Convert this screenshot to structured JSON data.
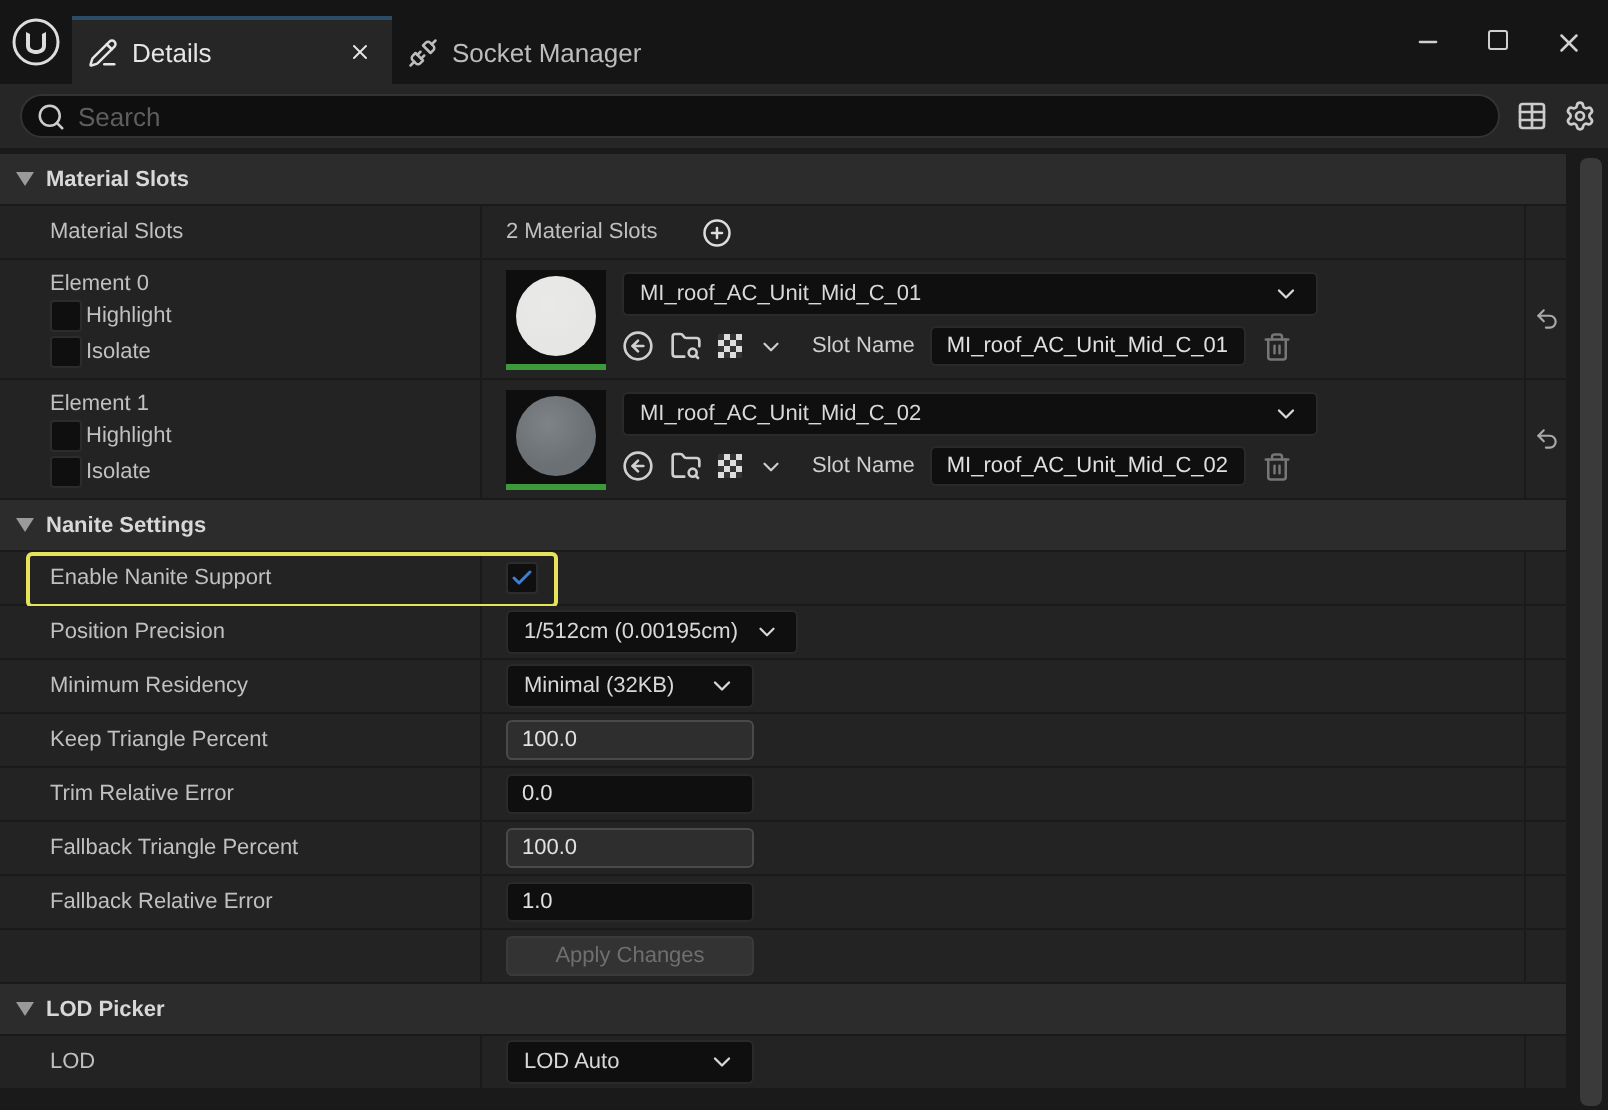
{
  "tabs": [
    {
      "label": "Details",
      "selected": true,
      "closable": true
    },
    {
      "label": "Socket Manager",
      "selected": false,
      "closable": false
    }
  ],
  "search": {
    "placeholder": "Search"
  },
  "sections": [
    {
      "title": "Material Slots",
      "expanded": true,
      "rows": [
        {
          "kind": "count",
          "label": "Material Slots",
          "value": "2 Material Slots"
        },
        {
          "kind": "material",
          "label": "Element 0",
          "color": "#e6e6e4",
          "options": [
            {
              "label": "Highlight",
              "checked": false
            },
            {
              "label": "Isolate",
              "checked": false
            }
          ],
          "material": "MI_roof_AC_Unit_Mid_C_01",
          "slot_label": "Slot Name",
          "slot_name": "MI_roof_AC_Unit_Mid_C_01",
          "resettable": true
        },
        {
          "kind": "material",
          "label": "Element 1",
          "color": "#6b7075",
          "options": [
            {
              "label": "Highlight",
              "checked": false
            },
            {
              "label": "Isolate",
              "checked": false
            }
          ],
          "material": "MI_roof_AC_Unit_Mid_C_02",
          "slot_label": "Slot Name",
          "slot_name": "MI_roof_AC_Unit_Mid_C_02",
          "resettable": true
        }
      ]
    },
    {
      "title": "Nanite Settings",
      "expanded": true,
      "rows": [
        {
          "kind": "checkbox",
          "label": "Enable Nanite Support",
          "checked": true,
          "highlighted": true
        },
        {
          "kind": "dropdown",
          "label": "Position Precision",
          "value": "1/512cm (0.00195cm)"
        },
        {
          "kind": "dropdown",
          "label": "Minimum Residency",
          "value": "Minimal (32KB)"
        },
        {
          "kind": "spinbox",
          "label": "Keep Triangle Percent",
          "value": "100.0"
        },
        {
          "kind": "number",
          "label": "Trim Relative Error",
          "value": "0.0"
        },
        {
          "kind": "spinbox",
          "label": "Fallback Triangle Percent",
          "value": "100.0"
        },
        {
          "kind": "number",
          "label": "Fallback Relative Error",
          "value": "1.0"
        },
        {
          "kind": "button",
          "label": "Apply Changes",
          "disabled": true
        }
      ]
    },
    {
      "title": "LOD Picker",
      "expanded": true,
      "rows": [
        {
          "kind": "dropdown",
          "label": "LOD",
          "value": "LOD Auto"
        }
      ]
    }
  ]
}
